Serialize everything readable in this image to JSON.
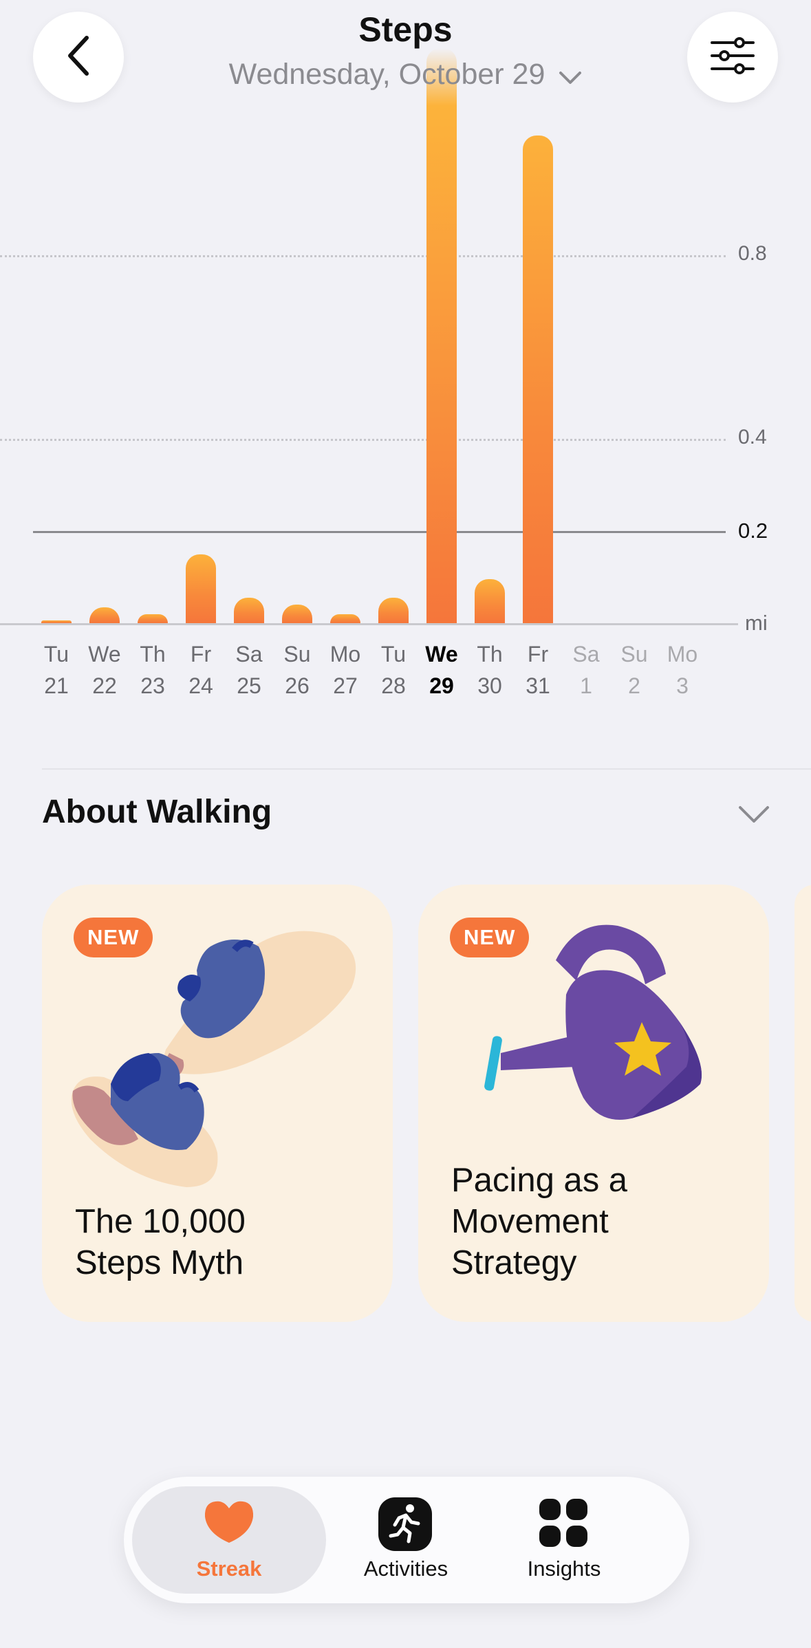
{
  "header": {
    "title": "Steps",
    "date": "Wednesday, October 29"
  },
  "chart_data": {
    "type": "bar",
    "unit": "mi",
    "y_ticks": [
      "0.8",
      "0.4"
    ],
    "goal": {
      "value": 0.2,
      "label": "0.2"
    },
    "ylim": [
      0,
      0.8
    ],
    "categories": [
      {
        "day": "Tu",
        "date": "21"
      },
      {
        "day": "We",
        "date": "22"
      },
      {
        "day": "Th",
        "date": "23"
      },
      {
        "day": "Fr",
        "date": "24"
      },
      {
        "day": "Sa",
        "date": "25"
      },
      {
        "day": "Su",
        "date": "26"
      },
      {
        "day": "Mo",
        "date": "27"
      },
      {
        "day": "Tu",
        "date": "28"
      },
      {
        "day": "We",
        "date": "29"
      },
      {
        "day": "Th",
        "date": "30"
      },
      {
        "day": "Fr",
        "date": "31"
      },
      {
        "day": "Sa",
        "date": "1"
      },
      {
        "day": "Su",
        "date": "2"
      },
      {
        "day": "Mo",
        "date": "3"
      }
    ],
    "values": [
      0.005,
      0.035,
      0.02,
      0.15,
      0.055,
      0.04,
      0.02,
      0.055,
      1.25,
      0.095,
      1.06,
      null,
      null,
      null
    ],
    "selected_index": 8,
    "future_indices": [
      11,
      12,
      13
    ],
    "grid": true,
    "colors": {
      "bar": "#f5763b",
      "bar_top": "#fcb13b",
      "goal_line": "#8a8a8e"
    }
  },
  "about": {
    "title": "About Walking",
    "cards": [
      {
        "badge": "NEW",
        "title_lines": [
          "The 10,000",
          "Steps Myth"
        ]
      },
      {
        "badge": "NEW",
        "title_lines": [
          "Pacing as a",
          "Movement",
          "Strategy"
        ]
      }
    ]
  },
  "tabs": [
    {
      "label": "Streak",
      "icon": "heart-icon",
      "active": true
    },
    {
      "label": "Activities",
      "icon": "running-icon",
      "active": false
    },
    {
      "label": "Insights",
      "icon": "grid-icon",
      "active": false
    }
  ],
  "colors": {
    "accent": "#f5763b",
    "background": "#f1f1f6",
    "card": "#fbf1e2"
  }
}
